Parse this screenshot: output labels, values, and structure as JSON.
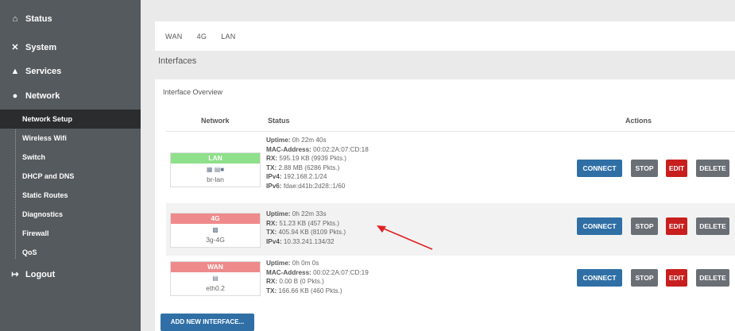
{
  "sidebar": {
    "items": [
      {
        "label": "Status",
        "icon": "home-icon"
      },
      {
        "label": "System",
        "icon": "tools-icon"
      },
      {
        "label": "Services",
        "icon": "services-icon"
      },
      {
        "label": "Network",
        "icon": "network-icon"
      }
    ],
    "network_sub": [
      {
        "label": "Network Setup",
        "active": true
      },
      {
        "label": "Wireless Wifi",
        "active": false
      },
      {
        "label": "Switch",
        "active": false
      },
      {
        "label": "DHCP and DNS",
        "active": false
      },
      {
        "label": "Static Routes",
        "active": false
      },
      {
        "label": "Diagnostics",
        "active": false
      },
      {
        "label": "Firewall",
        "active": false
      },
      {
        "label": "QoS",
        "active": false
      }
    ],
    "logout": "Logout"
  },
  "tabs": [
    "WAN",
    "4G",
    "LAN"
  ],
  "section_title": "Interfaces",
  "panel_title": "Interface Overview",
  "table": {
    "headers": {
      "network": "Network",
      "status": "Status",
      "actions": "Actions"
    }
  },
  "rows": [
    {
      "name": "LAN",
      "color": "#8fe08a",
      "device": "br-lan",
      "icon": "bridge-icon",
      "lines": [
        {
          "k": "Uptime:",
          "v": " 0h 22m 40s"
        },
        {
          "k": "MAC-Address:",
          "v": " 00:02:2A:07:CD:18"
        },
        {
          "k": "RX:",
          "v": " 595.19 KB (9939 Pkts.)"
        },
        {
          "k": "TX:",
          "v": " 2.88 MB (6286 Pkts.)"
        },
        {
          "k": "IPv4:",
          "v": " 192.168.2.1/24"
        },
        {
          "k": "IPv6:",
          "v": " fdae:d41b:2d28::1/60"
        }
      ]
    },
    {
      "name": "4G",
      "color": "#ef8a8a",
      "device": "3g-4G",
      "icon": "modem-icon",
      "lines": [
        {
          "k": "Uptime:",
          "v": " 0h 22m 33s"
        },
        {
          "k": "RX:",
          "v": " 51.23 KB (457 Pkts.)"
        },
        {
          "k": "TX:",
          "v": " 405.94 KB (8109 Pkts.)"
        },
        {
          "k": "IPv4:",
          "v": " 10.33.241.134/32"
        }
      ]
    },
    {
      "name": "WAN",
      "color": "#ef8a8a",
      "device": "eth0.2",
      "icon": "ethernet-icon",
      "lines": [
        {
          "k": "Uptime:",
          "v": " 0h 0m 0s"
        },
        {
          "k": "MAC-Address:",
          "v": " 00:02:2A:07:CD:19"
        },
        {
          "k": "RX:",
          "v": " 0.00 B (0 Pkts.)"
        },
        {
          "k": "TX:",
          "v": " 166.66 KB (460 Pkts.)"
        }
      ]
    }
  ],
  "buttons": {
    "connect": "CONNECT",
    "stop": "STOP",
    "edit": "EDIT",
    "delete": "DELETE"
  },
  "add_button": "ADD NEW INTERFACE...",
  "colors": {
    "accent": "#2f6fa6",
    "danger": "#c81e1e",
    "sidebar": "#555a5e"
  }
}
